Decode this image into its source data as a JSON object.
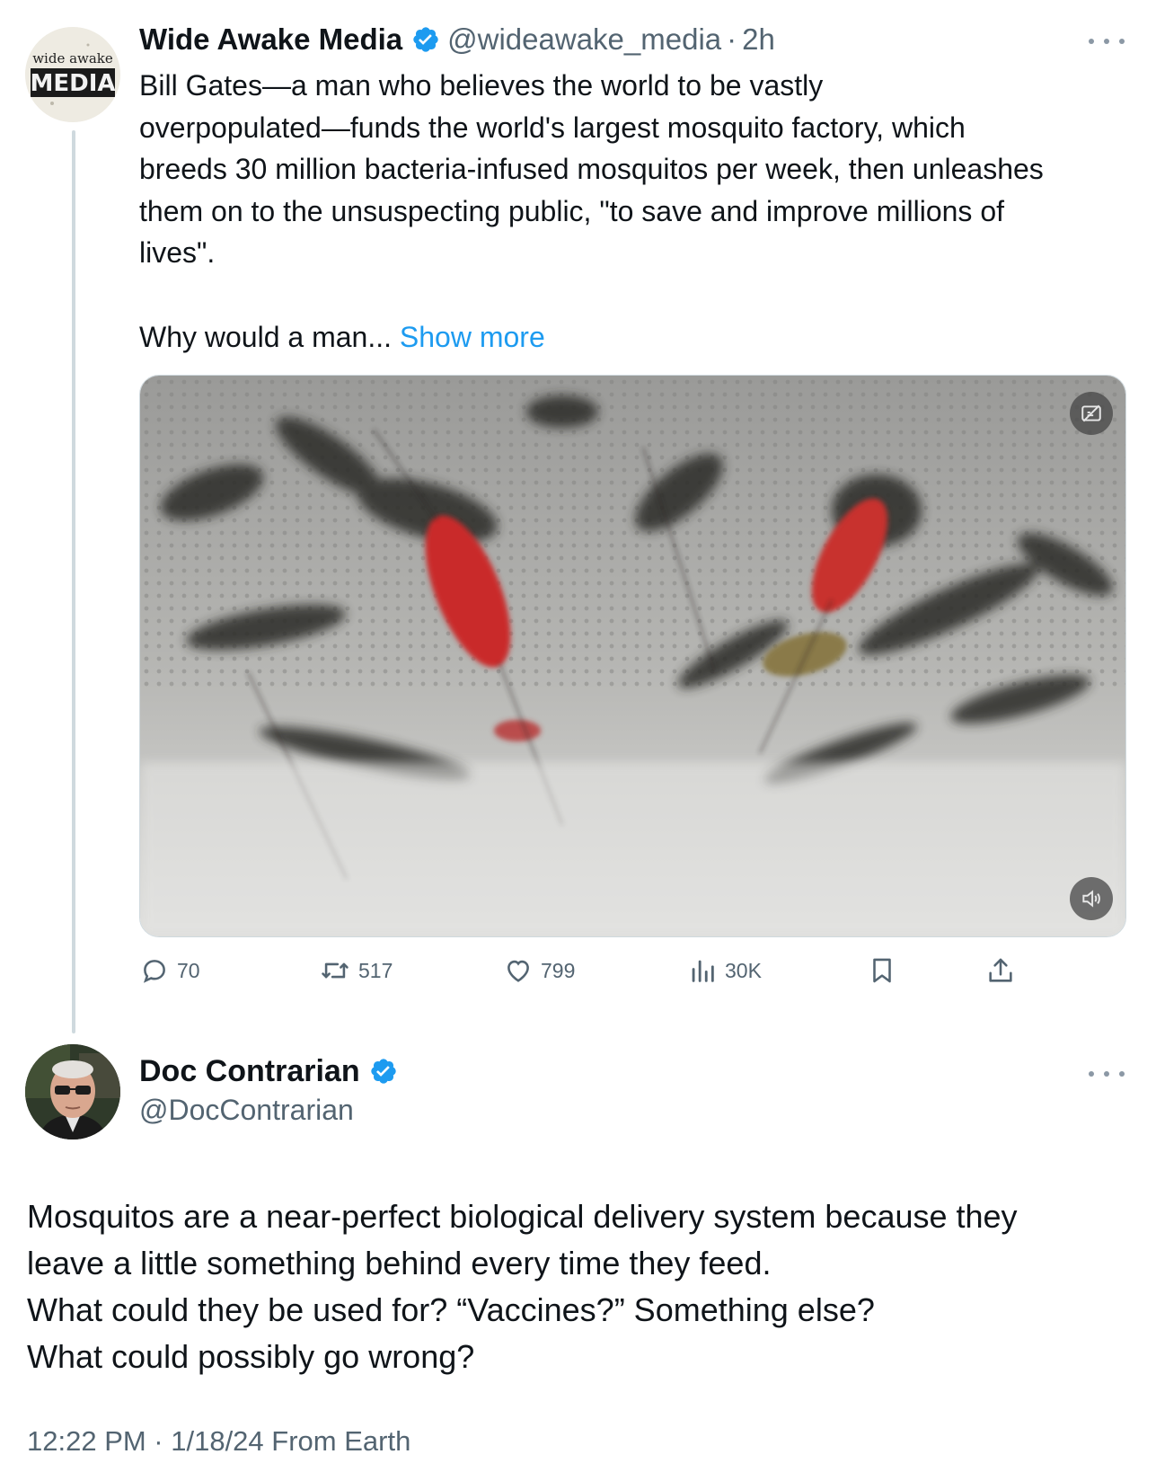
{
  "tweet1": {
    "avatar_logo": {
      "top": "wide awake",
      "bottom": "MEDIA"
    },
    "display_name": "Wide Awake Media",
    "handle": "@wideawake_media",
    "separator": "·",
    "time": "2h",
    "text_lines": [
      "Bill Gates—a man who believes the world to be vastly",
      "overpopulated—funds the world's largest mosquito factory, which",
      "breeds 30 million bacteria-infused mosquitos per week, then unleashes",
      "them on to the unsuspecting public, \"to save and improve millions of",
      "lives\"."
    ],
    "truncated_text": "Why would a man...",
    "show_more": "Show more",
    "media": {
      "type": "video",
      "description_icon": "captions-off-icon",
      "audio_icon": "volume-icon"
    },
    "actions": {
      "replies": "70",
      "reposts": "517",
      "likes": "799",
      "views": "30K"
    }
  },
  "tweet2": {
    "display_name": "Doc Contrarian",
    "handle": "@DocContrarian",
    "text_lines": [
      "Mosquitos are a near-perfect biological delivery system because they",
      "leave a little something behind every time they feed.",
      "What could they be used for? “Vaccines?” Something else?",
      "What could possibly go wrong?"
    ],
    "timestamp": "12:22 PM · 1/18/24 From Earth"
  },
  "colors": {
    "verified": "#1d9bf0",
    "link": "#1d9bf0",
    "secondary_text": "#536471",
    "thread_line": "#cfd9de"
  }
}
